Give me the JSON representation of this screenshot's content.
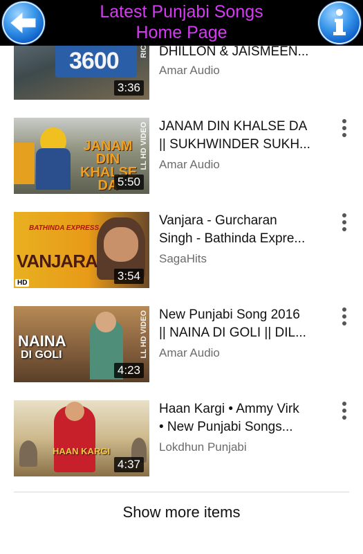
{
  "header": {
    "title_line1": "Latest Punjabi Songs",
    "title_line2": "Home Page",
    "back_icon": "back-arrow-icon",
    "info_icon": "info-icon"
  },
  "videos": [
    {
      "title_line1": "",
      "title_line2": "DHILLON & JAISMEEN...",
      "channel": "Amar Audio",
      "duration": "3:36",
      "thumb_text": "3600",
      "thumb_side": "RICAL V"
    },
    {
      "title_line1": "JANAM DIN KHALSE DA",
      "title_line2": "|| SUKHWINDER SUKH...",
      "channel": "Amar Audio",
      "duration": "5:50",
      "thumb_text": "JANAM DIN KHALSE DA",
      "thumb_side": "LL HD VIDEO"
    },
    {
      "title_line1": "Vanjara - Gurcharan",
      "title_line2": "Singh - Bathinda Expre...",
      "channel": "SagaHits",
      "duration": "3:54",
      "thumb_text": "VANJARA",
      "thumb_small": "BATHINDA EXPRESS",
      "thumb_badge": "HD"
    },
    {
      "title_line1": "New Punjabi Song 2016",
      "title_line2": "|| NAINA DI GOLI || DIL...",
      "channel": "Amar Audio",
      "duration": "4:23",
      "thumb_text": "NAINA",
      "thumb_small": "DI GOLI",
      "thumb_side": "LL HD VIDEO"
    },
    {
      "title_line1": "Haan Kargi • Ammy Virk",
      "title_line2": "• New Punjabi Songs...",
      "channel": "Lokdhun Punjabi",
      "duration": "4:37",
      "thumb_text": "HAAN KARGI"
    }
  ],
  "show_more": "Show more items"
}
